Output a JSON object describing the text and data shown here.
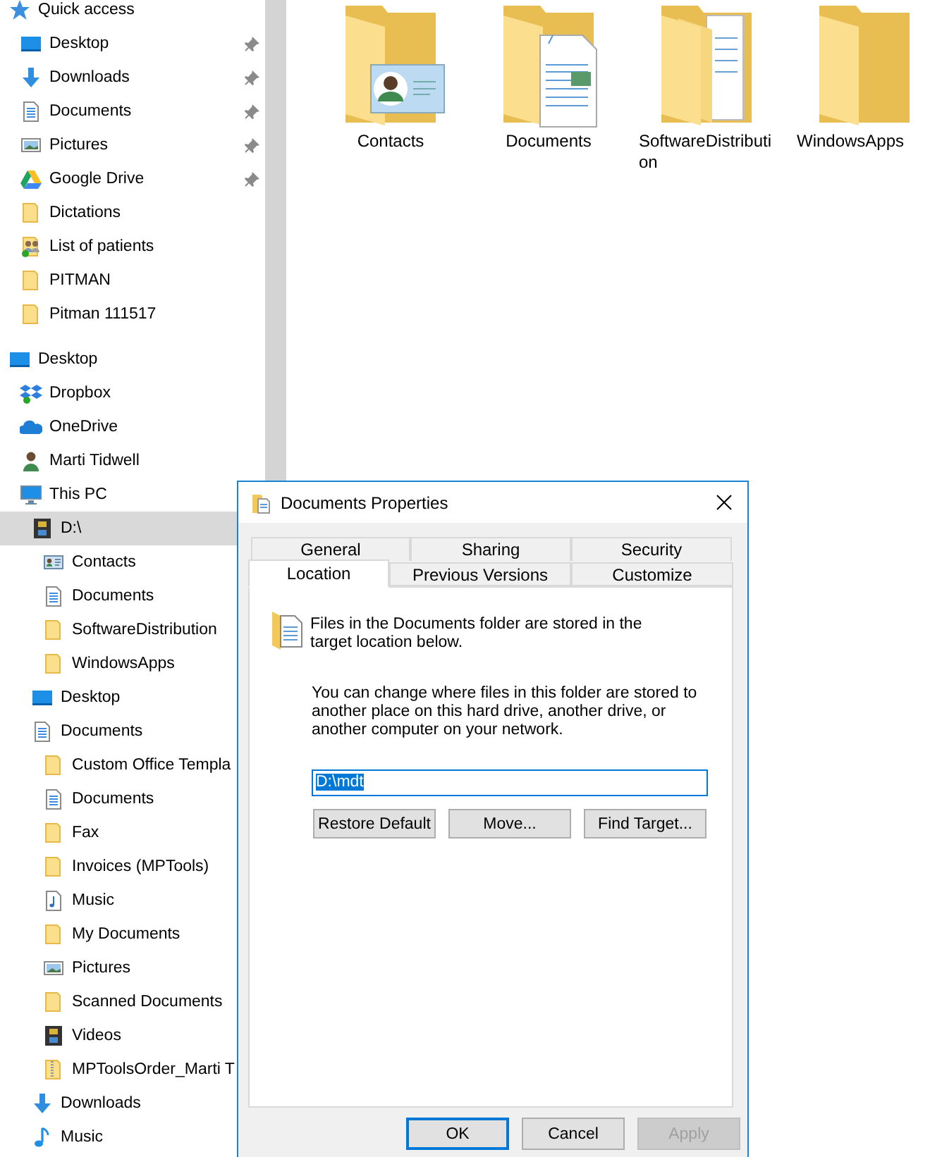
{
  "nav": [
    {
      "label": "Quick access",
      "kind": "star",
      "selected": false,
      "children": [
        {
          "label": "Desktop",
          "kind": "desktop",
          "pinned": true,
          "selected": false
        },
        {
          "label": "Downloads",
          "kind": "downloads",
          "pinned": true,
          "selected": false
        },
        {
          "label": "Documents",
          "kind": "documents",
          "pinned": true,
          "selected": false
        },
        {
          "label": "Pictures",
          "kind": "pictures",
          "pinned": true,
          "selected": false
        },
        {
          "label": "Google Drive",
          "kind": "gdrive",
          "pinned": true,
          "selected": false
        },
        {
          "label": "Dictations",
          "kind": "folder",
          "pinned": false,
          "selected": false
        },
        {
          "label": "List of patients",
          "kind": "shared",
          "pinned": false,
          "selected": false
        },
        {
          "label": "PITMAN",
          "kind": "folder",
          "pinned": false,
          "selected": false
        },
        {
          "label": "Pitman 111517",
          "kind": "folder",
          "pinned": false,
          "selected": false
        }
      ]
    },
    {
      "label": "Desktop",
      "kind": "desktop",
      "selected": false,
      "children": [
        {
          "label": "Dropbox",
          "kind": "dropbox",
          "selected": false
        },
        {
          "label": "OneDrive",
          "kind": "onedrive",
          "selected": false
        },
        {
          "label": "Marti Tidwell",
          "kind": "user",
          "selected": false
        },
        {
          "label": "This PC",
          "kind": "computer",
          "selected": false,
          "children": [
            {
              "label": "D:\\",
              "kind": "drive",
              "selected": true,
              "children": [
                {
                  "label": "Contacts",
                  "kind": "contacts",
                  "selected": false
                },
                {
                  "label": "Documents",
                  "kind": "documents",
                  "selected": false
                },
                {
                  "label": "SoftwareDistribution",
                  "kind": "folder",
                  "selected": false
                },
                {
                  "label": "WindowsApps",
                  "kind": "folder",
                  "selected": false
                }
              ]
            },
            {
              "label": "Desktop",
              "kind": "desktop",
              "selected": false
            },
            {
              "label": "Documents",
              "kind": "documents",
              "selected": false,
              "children": [
                {
                  "label": "Custom Office Templa",
                  "kind": "folder",
                  "selected": false
                },
                {
                  "label": "Documents",
                  "kind": "documents",
                  "selected": false
                },
                {
                  "label": "Fax",
                  "kind": "folder",
                  "selected": false
                },
                {
                  "label": "Invoices (MPTools)",
                  "kind": "folder",
                  "selected": false
                },
                {
                  "label": "Music",
                  "kind": "music-file",
                  "selected": false
                },
                {
                  "label": "My Documents",
                  "kind": "folder",
                  "selected": false
                },
                {
                  "label": "Pictures",
                  "kind": "pictures",
                  "selected": false
                },
                {
                  "label": "Scanned Documents",
                  "kind": "folder",
                  "selected": false
                },
                {
                  "label": "Videos",
                  "kind": "videos",
                  "selected": false
                },
                {
                  "label": "MPToolsOrder_Marti T",
                  "kind": "zip",
                  "selected": false
                }
              ]
            },
            {
              "label": "Downloads",
              "kind": "downloads",
              "selected": false
            },
            {
              "label": "Music",
              "kind": "music",
              "selected": false
            }
          ]
        }
      ]
    }
  ],
  "items": [
    {
      "label": "Contacts",
      "kind": "contacts"
    },
    {
      "label": "Documents",
      "kind": "documents"
    },
    {
      "label": "SoftwareDistribution",
      "kind": "folder-docs"
    },
    {
      "label": "WindowsApps",
      "kind": "folder"
    }
  ],
  "dialog": {
    "title": "Documents Properties",
    "tab_rows": [
      {
        "tabs": [
          {
            "label": "General",
            "selected": false
          },
          {
            "label": "Sharing",
            "selected": false
          },
          {
            "label": "Security",
            "selected": false
          }
        ]
      },
      {
        "tabs": [
          {
            "label": "Location",
            "selected": true
          },
          {
            "label": "Previous Versions",
            "selected": false
          },
          {
            "label": "Customize",
            "selected": false
          }
        ]
      }
    ],
    "info": "Files in the Documents folder are stored in the target location below.",
    "hint": "You can change where files in this folder are stored to another place on this hard drive, another drive, or another computer on your network.",
    "path": "D:\\mdt",
    "actions": [
      "Restore Default",
      "Move...",
      "Find Target..."
    ],
    "buttons": [
      {
        "label": "OK",
        "default": true,
        "disabled": false
      },
      {
        "label": "Cancel",
        "default": false,
        "disabled": false
      },
      {
        "label": "Apply",
        "default": false,
        "disabled": true
      }
    ]
  }
}
